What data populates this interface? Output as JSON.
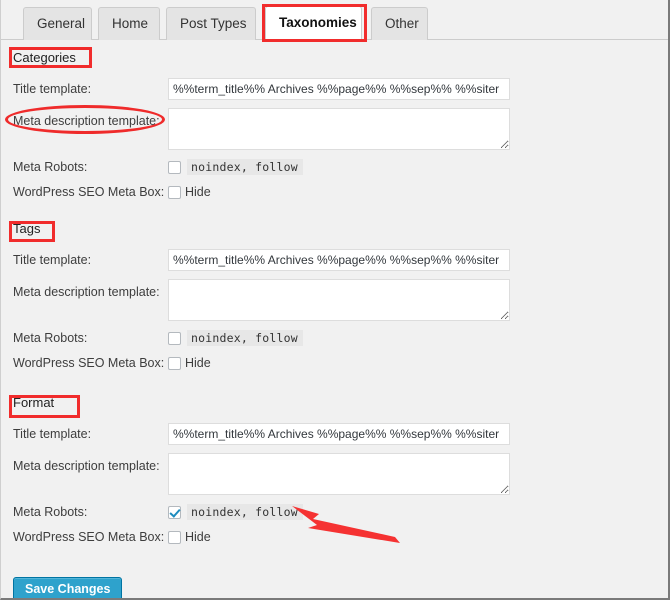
{
  "tabs": [
    {
      "label": "General",
      "active": false
    },
    {
      "label": "Home",
      "active": false
    },
    {
      "label": "Post Types",
      "active": false
    },
    {
      "label": "Taxonomies",
      "active": true
    },
    {
      "label": "Other",
      "active": false
    }
  ],
  "labels": {
    "title_template": "Title template:",
    "meta_description_template": "Meta description template:",
    "meta_robots": "Meta Robots:",
    "wp_seo_meta_box": "WordPress SEO Meta Box:",
    "noindex_follow": "noindex, follow",
    "hide": "Hide"
  },
  "sections": [
    {
      "heading": "Categories",
      "title_template_value": "%%term_title%% Archives %%page%% %%sep%% %%siter",
      "meta_description_value": "",
      "meta_robots_checked": false,
      "meta_box_hide_checked": false
    },
    {
      "heading": "Tags",
      "title_template_value": "%%term_title%% Archives %%page%% %%sep%% %%siter",
      "meta_description_value": "",
      "meta_robots_checked": false,
      "meta_box_hide_checked": false
    },
    {
      "heading": "Format",
      "title_template_value": "%%term_title%% Archives %%page%% %%sep%% %%siter",
      "meta_description_value": "",
      "meta_robots_checked": true,
      "meta_box_hide_checked": false
    }
  ],
  "footer": {
    "save_label": "Save Changes"
  },
  "colors": {
    "annotation_red": "#f12c2c",
    "button_blue": "#2ea2cc",
    "button_border": "#0074a2",
    "checkbox_check": "#1e8cbe",
    "page_background": "#f1f1f1"
  },
  "annotations": {
    "tab_highlight": "Taxonomies",
    "section_highlights": [
      "Categories",
      "Tags",
      "Format"
    ],
    "ellipse_target": "Meta description template:",
    "arrow_target": "noindex, follow"
  }
}
